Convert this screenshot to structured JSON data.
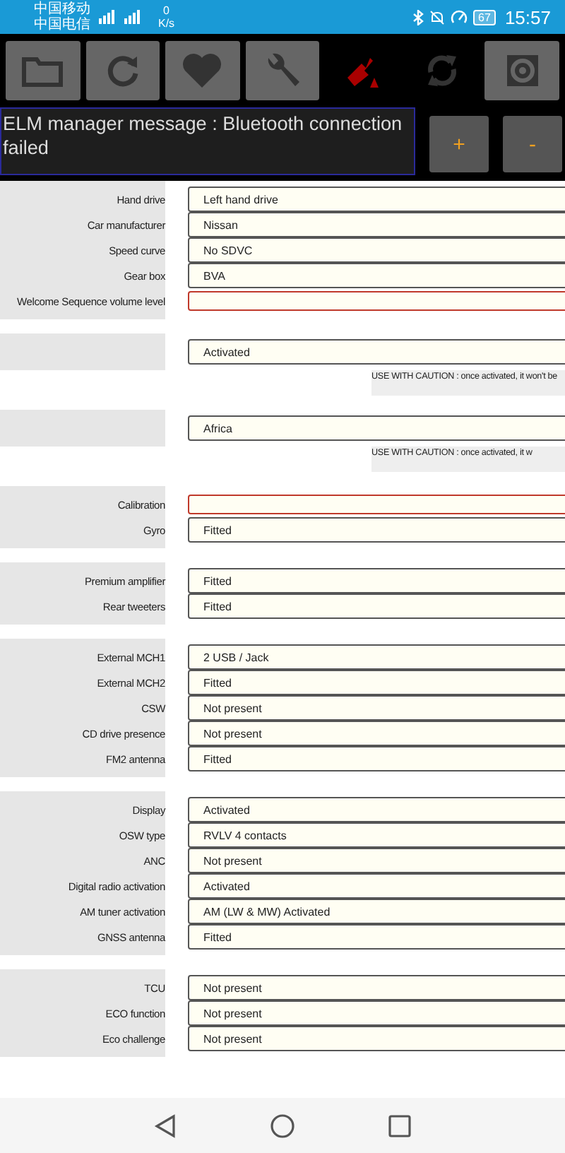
{
  "status_bar": {
    "carriers": [
      "中国移动",
      "中国电信"
    ],
    "speed_value": "0",
    "speed_unit": "K/s",
    "battery": "67",
    "time": "15:57"
  },
  "toolbar": {
    "buttons": [
      {
        "kind": "folder"
      },
      {
        "kind": "refresh"
      },
      {
        "kind": "heart"
      },
      {
        "kind": "wrench"
      },
      {
        "kind": "bt-off"
      },
      {
        "kind": "sync"
      },
      {
        "kind": "gear"
      }
    ]
  },
  "message": {
    "text": "ELM manager message : Bluetooth connection failed",
    "buttons": [
      "+",
      "-"
    ]
  },
  "sections": [
    {
      "rows": [
        {
          "label": "Hand drive",
          "value": "Left hand drive",
          "invalid": false
        },
        {
          "label": "Car manufacturer",
          "value": "Nissan",
          "invalid": false
        },
        {
          "label": "Speed curve",
          "value": "No SDVC",
          "invalid": false
        },
        {
          "label": "Gear box",
          "value": "BVA",
          "invalid": false
        },
        {
          "label": "Welcome Sequence volume level",
          "invalid": true
        }
      ]
    },
    {
      "rows": [
        {
          "value": "Activated",
          "invalid": false
        }
      ],
      "note": "USE WITH CAUTION : once activated, it won't be"
    },
    {
      "rows": [
        {
          "value": "Africa",
          "invalid": false
        }
      ],
      "note": "USE WITH CAUTION : once activated, it w"
    },
    {
      "rows": [
        {
          "label": "Calibration",
          "invalid": true
        },
        {
          "label": "Gyro",
          "value": "Fitted",
          "invalid": false
        }
      ]
    },
    {
      "rows": [
        {
          "label": "Premium amplifier",
          "value": "Fitted",
          "invalid": false
        },
        {
          "label": "Rear tweeters",
          "value": "Fitted",
          "invalid": false
        }
      ]
    },
    {
      "rows": [
        {
          "label": "External MCH1",
          "value": "2 USB / Jack",
          "invalid": false
        },
        {
          "label": "External MCH2",
          "value": "Fitted",
          "invalid": false
        },
        {
          "label": "CSW",
          "value": "Not present",
          "invalid": false
        },
        {
          "label": "CD drive presence",
          "value": "Not present",
          "invalid": false
        },
        {
          "label": "FM2 antenna",
          "value": "Fitted",
          "invalid": false
        }
      ]
    },
    {
      "rows": [
        {
          "label": "Display",
          "value": "Activated",
          "invalid": false
        },
        {
          "label": "OSW type",
          "value": "RVLV 4 contacts",
          "invalid": false
        },
        {
          "label": "ANC",
          "value": "Not present",
          "invalid": false
        },
        {
          "label": "Digital radio activation",
          "value": "Activated",
          "invalid": false
        },
        {
          "label": "AM tuner activation",
          "value": "AM (LW & MW) Activated",
          "invalid": false
        },
        {
          "label": "GNSS antenna",
          "value": "Fitted",
          "invalid": false
        }
      ]
    },
    {
      "rows": [
        {
          "label": "TCU",
          "value": "Not present",
          "invalid": false
        },
        {
          "label": "ECO function",
          "value": "Not present",
          "invalid": false
        },
        {
          "label": "Eco challenge",
          "value": "Not present",
          "invalid": false
        }
      ]
    }
  ]
}
